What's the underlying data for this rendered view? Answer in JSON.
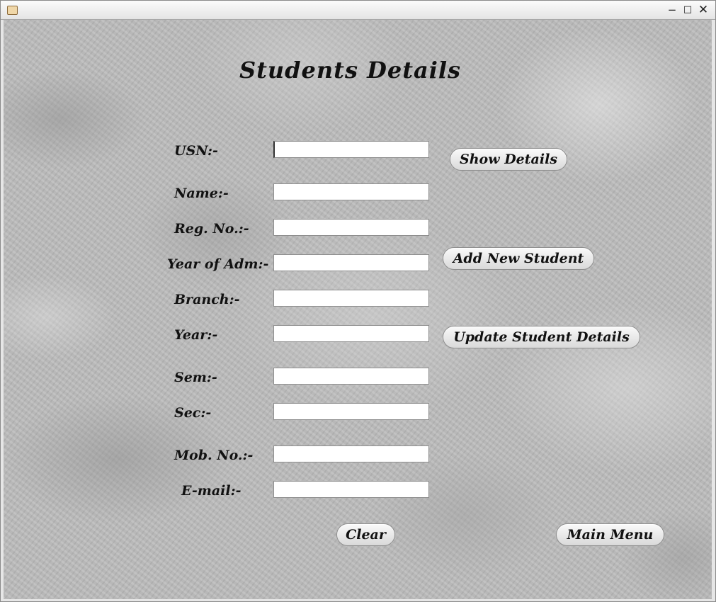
{
  "window": {
    "minimize": "−",
    "maximize": "□",
    "close": "✕"
  },
  "title": "Students Details",
  "labels": {
    "usn": "USN:-",
    "name": "Name:-",
    "reg_no": "Reg. No.:-",
    "year_of_adm": "Year of Adm:-",
    "branch": "Branch:-",
    "year": "Year:-",
    "sem": "Sem:-",
    "sec": "Sec:-",
    "mob_no": "Mob. No.:-",
    "email": "E-mail:-"
  },
  "fields": {
    "usn": "",
    "name": "",
    "reg_no": "",
    "year_of_adm": "",
    "branch": "",
    "year": "",
    "sem": "",
    "sec": "",
    "mob_no": "",
    "email": ""
  },
  "buttons": {
    "show_details": "Show Details",
    "add_new_student": "Add New Student",
    "update_student_details": "Update Student Details",
    "clear": "Clear",
    "main_menu": "Main Menu"
  },
  "icons": {
    "app": "java-app-icon"
  }
}
